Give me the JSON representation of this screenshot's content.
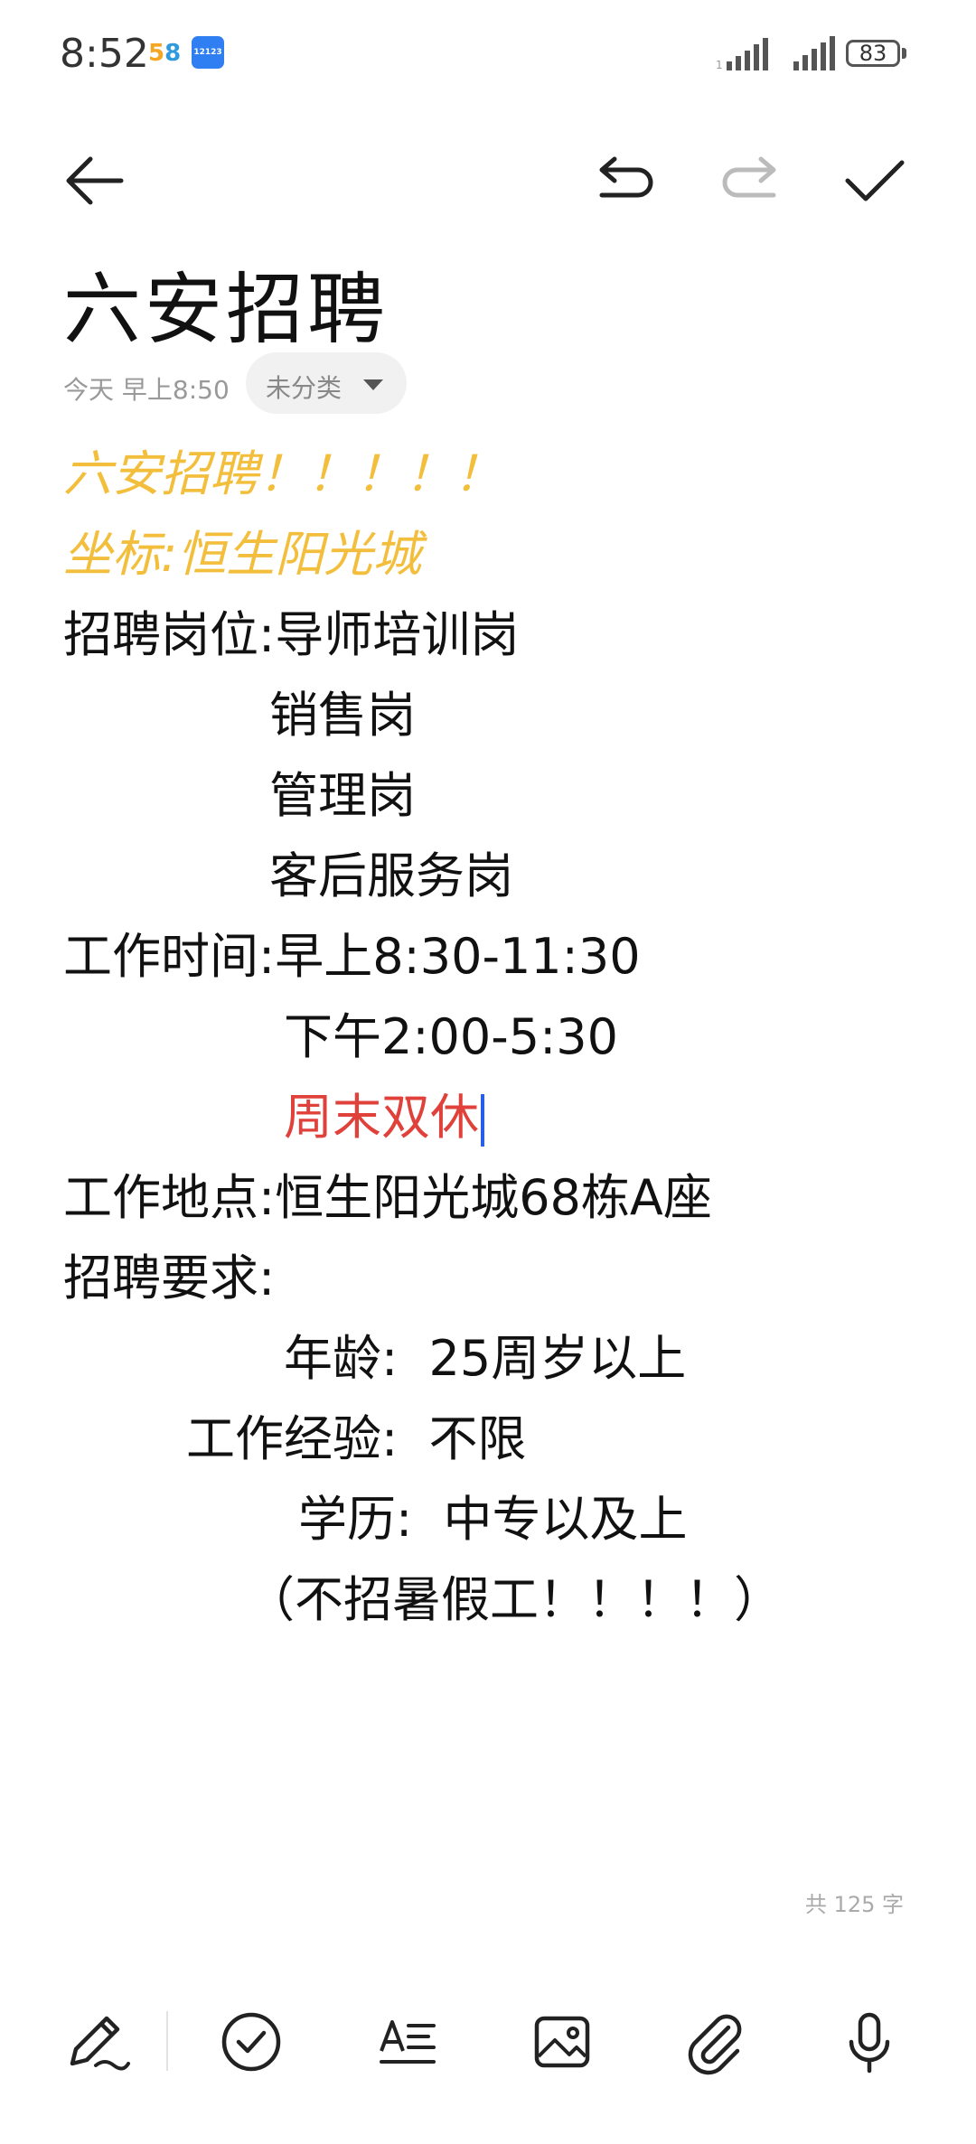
{
  "status_bar": {
    "time": "8:52",
    "app_58": "58",
    "app_12123": "12123",
    "battery": "83"
  },
  "toolbar": {
    "back_icon": "arrow-left",
    "undo_icon": "undo",
    "redo_icon": "redo",
    "done_icon": "checkmark"
  },
  "note": {
    "title": "六安招聘",
    "date": "今天 早上8:50",
    "category": "未分类",
    "lines": [
      "六安招聘！！！！！",
      "坐标:恒生阳光城",
      "招聘岗位:导师培训岗",
      "销售岗",
      "管理岗",
      "客后服务岗",
      "工作时间:早上8:30-11:30",
      "下午2:00-5:30",
      "周末双休",
      "工作地点:恒生阳光城68栋A座",
      "招聘要求:",
      "年龄:  25周岁以上",
      "工作经验:  不限",
      "学历:  中专以及上",
      "（不招暑假工！！！！）"
    ],
    "word_count": "共 125 字"
  },
  "bottom_toolbar": {
    "icons": [
      "pen-icon",
      "checklist-icon",
      "text-format-icon",
      "image-icon",
      "attachment-icon",
      "microphone-icon"
    ]
  },
  "colors": {
    "highlight_yellow": "#f2be3c",
    "highlight_red": "#e0413a",
    "cursor_blue": "#2b5ee8"
  }
}
